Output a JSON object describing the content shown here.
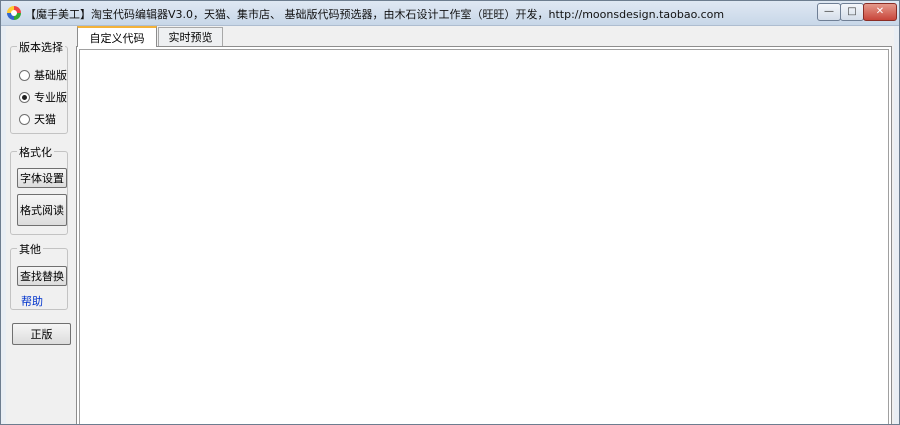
{
  "window": {
    "title": "【魔手美工】淘宝代码编辑器V3.0，天猫、集市店、 基础版代码预选器，由木石设计工作室（旺旺）开发，http://moonsdesign.taobao.com",
    "minimize_glyph": "—",
    "maximize_glyph": "□",
    "close_glyph": "✕"
  },
  "sidebar": {
    "version_group": {
      "title": "版本选择",
      "options": [
        {
          "label": "基础版",
          "checked": false
        },
        {
          "label": "专业版",
          "checked": true
        },
        {
          "label": "天猫",
          "checked": false
        }
      ]
    },
    "format_group": {
      "title": "格式化",
      "font_button": "字体设置",
      "read_button": "格式阅读"
    },
    "other_group": {
      "title": "其他",
      "find_button": "查找替换",
      "help_link": "帮助"
    },
    "genuine_button": "正版"
  },
  "tabs": [
    {
      "label": "自定义代码",
      "active": true
    },
    {
      "label": "实时预览",
      "active": false
    }
  ],
  "editor": {
    "content": ""
  }
}
